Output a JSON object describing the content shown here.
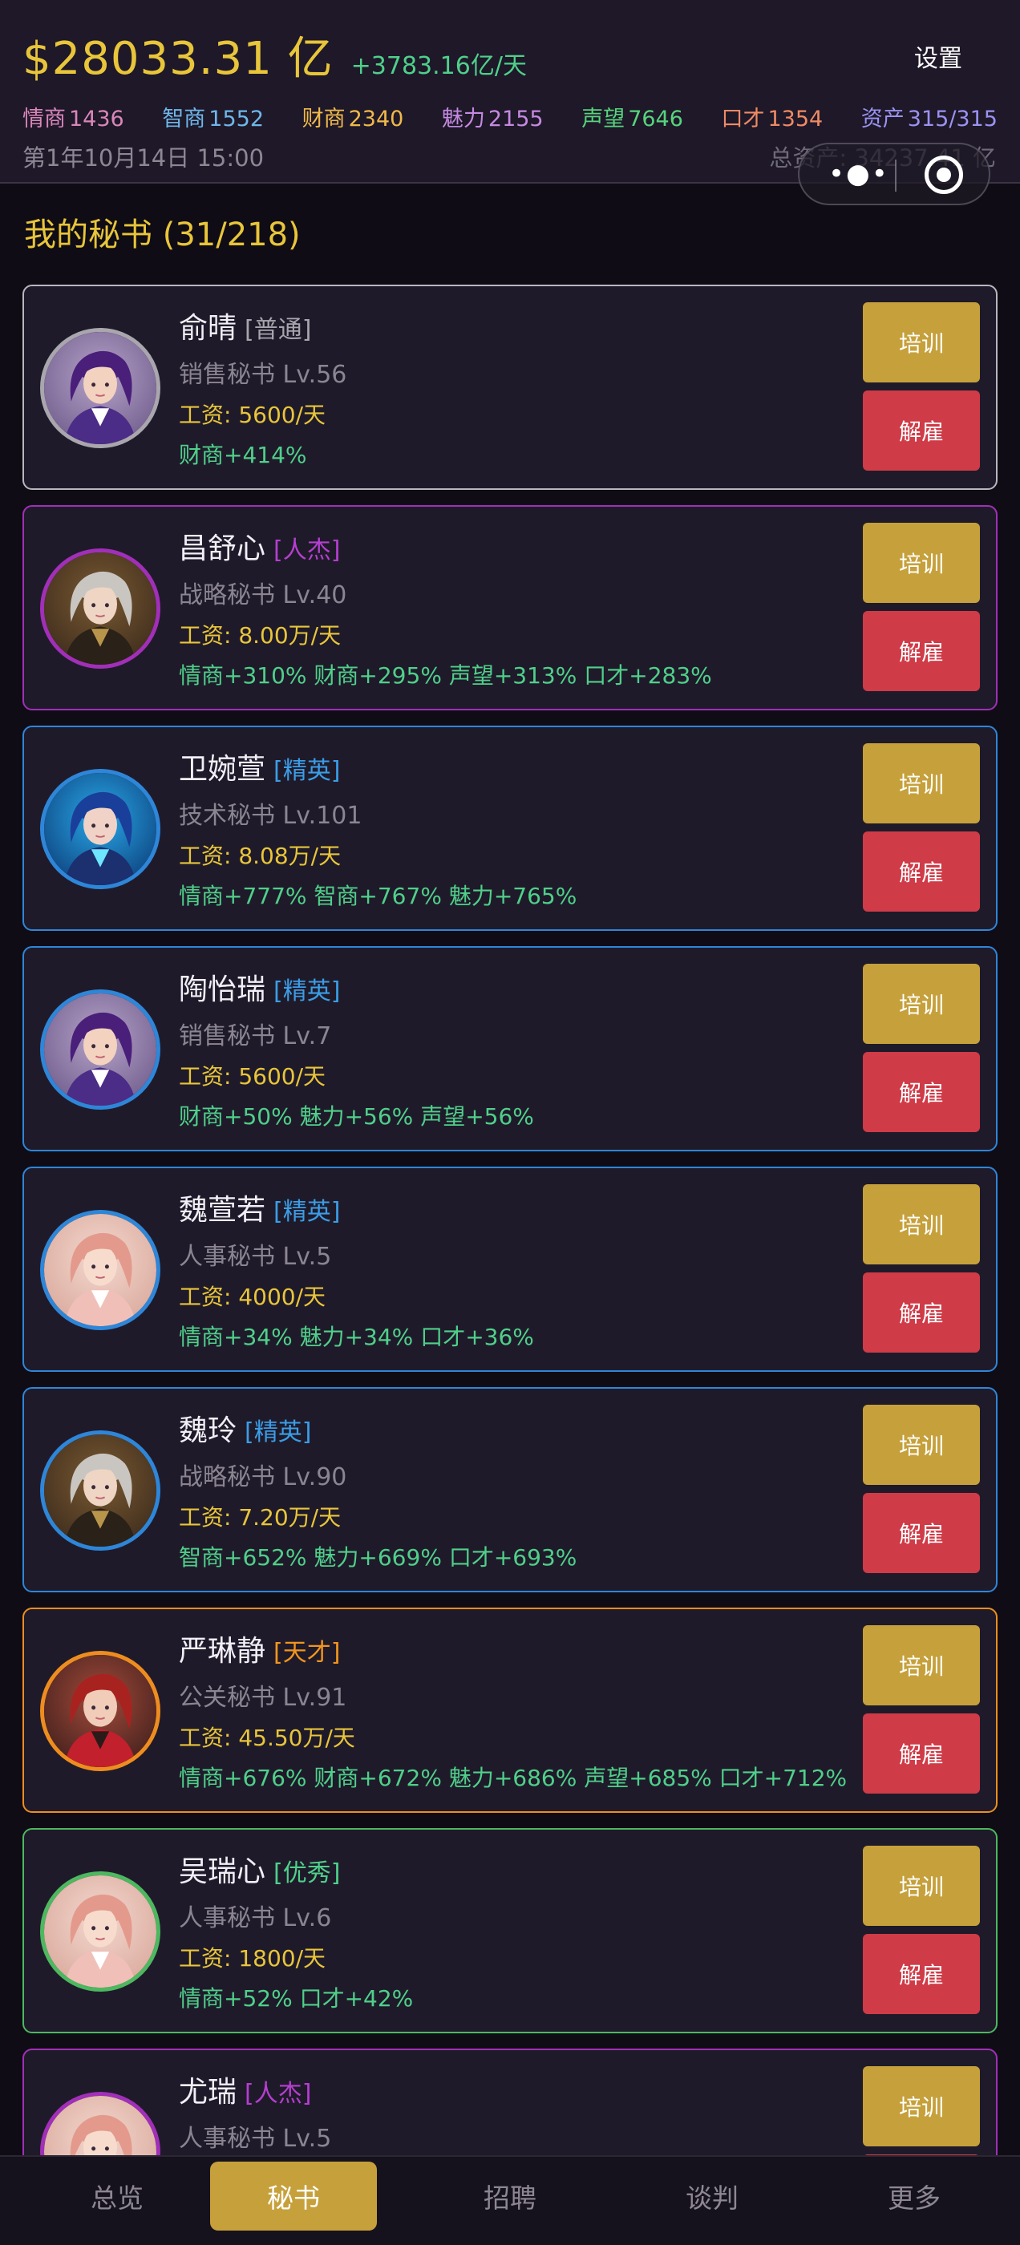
{
  "header": {
    "money": "$28033.31 亿",
    "income": "+3783.16亿/天",
    "settings_label": "设置",
    "stats": [
      {
        "key": "情商",
        "value": "1436",
        "cls": "s-eq"
      },
      {
        "key": "智商",
        "value": "1552",
        "cls": "s-iq"
      },
      {
        "key": "财商",
        "value": "2340",
        "cls": "s-fq"
      },
      {
        "key": "魅力",
        "value": "2155",
        "cls": "s-ch"
      },
      {
        "key": "声望",
        "value": "7646",
        "cls": "s-rep"
      },
      {
        "key": "口才",
        "value": "1354",
        "cls": "s-elo"
      },
      {
        "key": "资产",
        "value": "315/315",
        "cls": "s-ast"
      }
    ],
    "date": "第1年10月14日 15:00",
    "total_assets": "总资产: 34237.41 亿"
  },
  "capsule": {
    "more_icon": "more-dots-icon",
    "close_icon": "target-ring-icon"
  },
  "section_title": "我的秘书 (31/218)",
  "actions": {
    "train_label": "培训",
    "fire_label": "解雇"
  },
  "colors": {
    "accent_gold": "#c6a03b",
    "danger_red": "#cf3b47",
    "bonus_green": "#4fd08a",
    "salary_yellow": "#e8c53a"
  },
  "secretaries": [
    {
      "name": "俞晴",
      "rank": "[普通]",
      "tier": "normal",
      "role": "销售秘书 Lv.56",
      "salary": "工资: 5600/天",
      "bonus": "财商+414%",
      "avatar": "purple-suit-avatar"
    },
    {
      "name": "昌舒心",
      "rank": "[人杰]",
      "tier": "hero",
      "role": "战略秘书 Lv.40",
      "salary": "工资: 8.00万/天",
      "bonus": "情商+310% 财商+295% 声望+313% 口才+283%",
      "avatar": "silver-hair-avatar"
    },
    {
      "name": "卫婉萱",
      "rank": "[精英]",
      "tier": "elite",
      "role": "技术秘书 Lv.101",
      "salary": "工资: 8.08万/天",
      "bonus": "情商+777% 智商+767% 魅力+765%",
      "avatar": "blue-tech-avatar"
    },
    {
      "name": "陶怡瑞",
      "rank": "[精英]",
      "tier": "elite",
      "role": "销售秘书 Lv.7",
      "salary": "工资: 5600/天",
      "bonus": "财商+50% 魅力+56% 声望+56%",
      "avatar": "purple-suit-avatar"
    },
    {
      "name": "魏萱若",
      "rank": "[精英]",
      "tier": "elite",
      "role": "人事秘书 Lv.5",
      "salary": "工资: 4000/天",
      "bonus": "情商+34% 魅力+34% 口才+36%",
      "avatar": "pink-hair-avatar"
    },
    {
      "name": "魏玲",
      "rank": "[精英]",
      "tier": "elite",
      "role": "战略秘书 Lv.90",
      "salary": "工资: 7.20万/天",
      "bonus": "智商+652% 魅力+669% 口才+693%",
      "avatar": "silver-hair-avatar"
    },
    {
      "name": "严琳静",
      "rank": "[天才]",
      "tier": "genius",
      "role": "公关秘书 Lv.91",
      "salary": "工资: 45.50万/天",
      "bonus": "情商+676% 财商+672% 魅力+686% 声望+685% 口才+712%",
      "avatar": "red-hair-avatar"
    },
    {
      "name": "吴瑞心",
      "rank": "[优秀]",
      "tier": "good",
      "role": "人事秘书 Lv.6",
      "salary": "工资: 1800/天",
      "bonus": "情商+52% 口才+42%",
      "avatar": "pink-hair-avatar"
    },
    {
      "name": "尤瑞",
      "rank": "[人杰]",
      "tier": "hero",
      "role": "人事秘书 Lv.5",
      "salary": "",
      "bonus": "",
      "avatar": "pink-hair-avatar"
    }
  ],
  "nav": {
    "items": [
      {
        "label": "总览",
        "active": false
      },
      {
        "label": "秘书",
        "active": true
      },
      {
        "label": "招聘",
        "active": false
      },
      {
        "label": "谈判",
        "active": false
      },
      {
        "label": "更多",
        "active": false
      }
    ]
  }
}
